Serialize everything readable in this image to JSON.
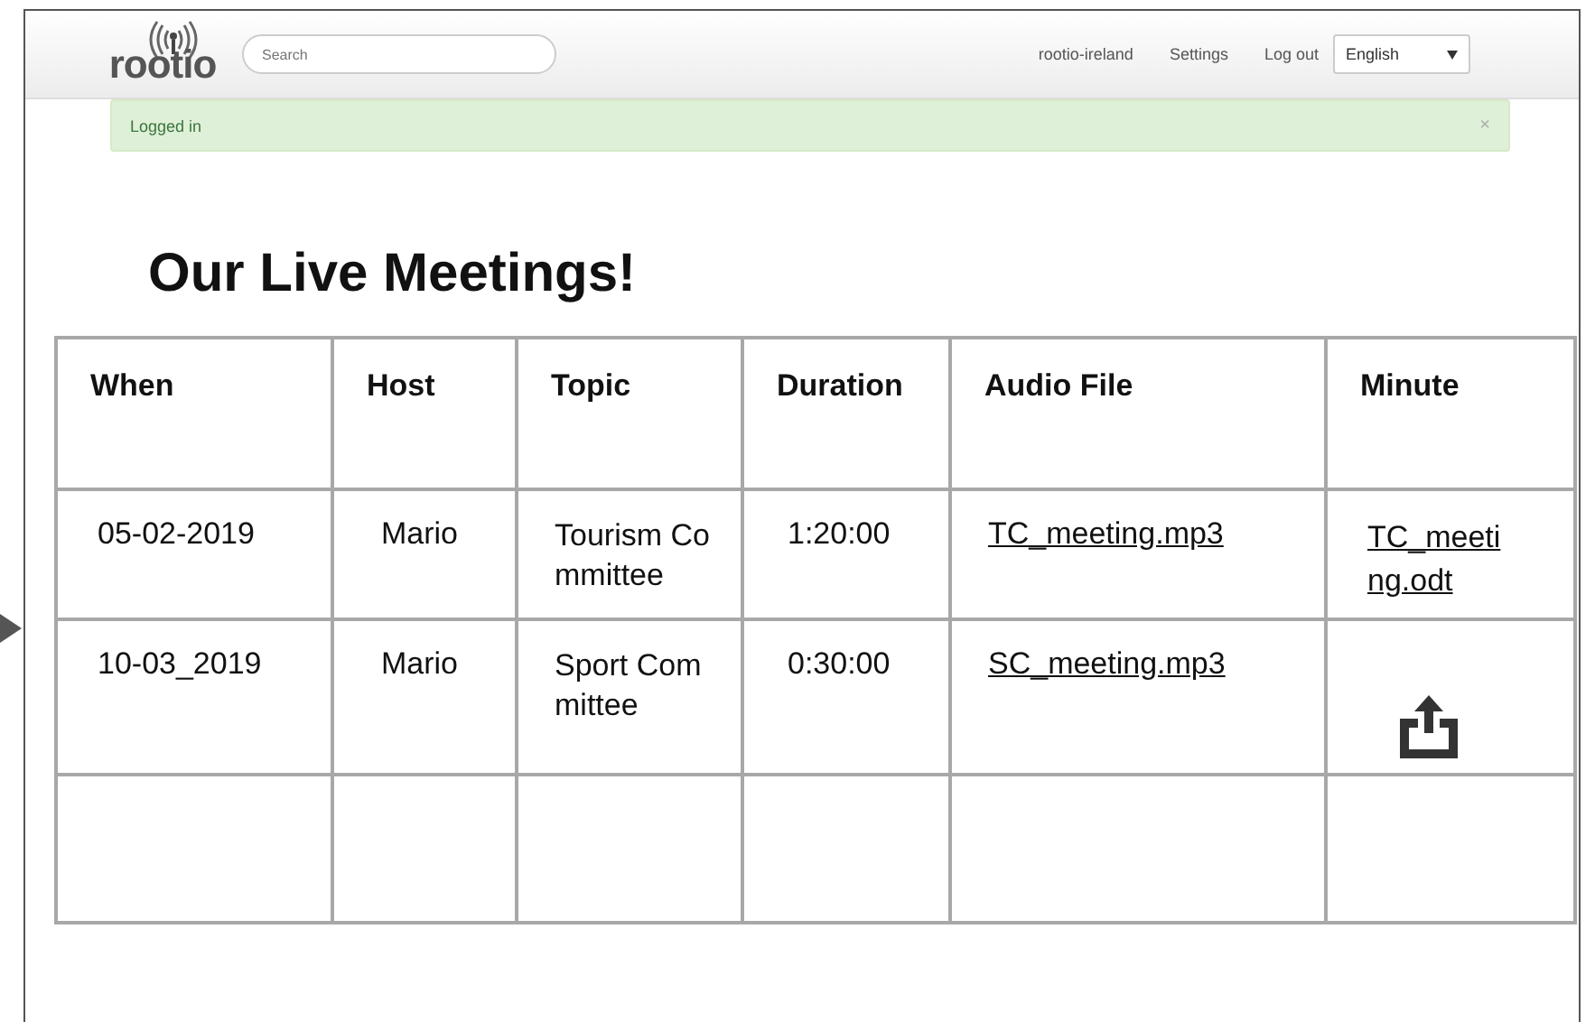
{
  "navbar": {
    "logo": "rootio",
    "search": {
      "placeholder": "Search"
    },
    "links": [
      "rootio-ireland",
      "Settings",
      "Log out"
    ],
    "language": "English"
  },
  "alert": {
    "message": "Logged in",
    "close": "×"
  },
  "title": "Our Live Meetings!",
  "table": {
    "columns": [
      "When",
      "Host",
      "Topic",
      "Duration",
      "Audio File",
      "Minute"
    ],
    "rows": [
      {
        "kind": "meeting",
        "when": "05-02-2019",
        "host": "Mario",
        "topic": "Tourism Committee",
        "duration": "1:20:00",
        "audio": "TC_meeting.mp3",
        "minute": {
          "kind": "link",
          "text": "TC_meeting.odt"
        }
      },
      {
        "kind": "meeting",
        "when": "10-03_2019",
        "host": "Mario",
        "topic": "Sport Committee",
        "duration": "0:30:00",
        "audio": "SC_meeting.mp3",
        "minute": {
          "kind": "upload"
        }
      },
      {
        "kind": "blank"
      }
    ]
  }
}
